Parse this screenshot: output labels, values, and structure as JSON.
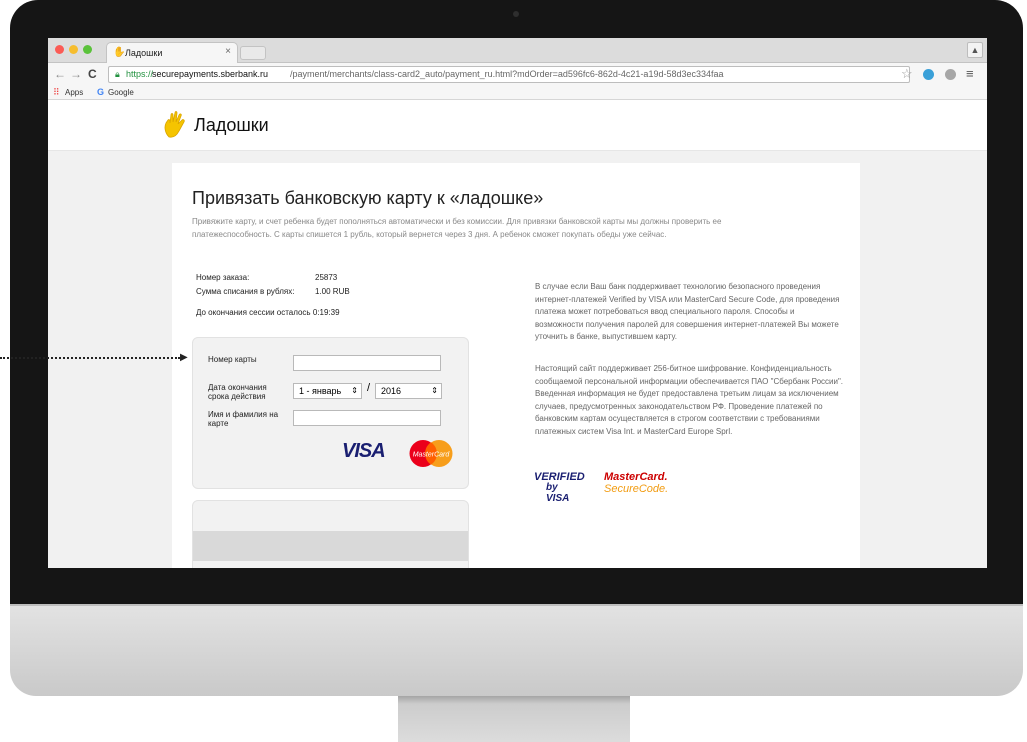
{
  "browser": {
    "tab_title": "Ладошки",
    "tab_close": "×",
    "url_https": "https://",
    "url_host": "securepayments.sberbank.ru",
    "url_path": "/payment/merchants/class-card2_auto/payment_ru.html?mdOrder=ad596fc6-862d-4c21-a19d-58d3ec334faa",
    "bookmarks": [
      {
        "label": "Apps",
        "icon": "apps-grid-icon"
      },
      {
        "label": "Google",
        "icon": "google-icon"
      }
    ]
  },
  "site": {
    "logo_text": "Ладошки",
    "logo_icon": "hand-icon"
  },
  "page": {
    "title": "Привязать банковскую карту к «ладошке»",
    "intro_line_1": "Привяжите карту, и счет ребенка будет пополняться автоматически и без комиссии. Для привязки банковской карты мы должны проверить ее",
    "intro_line_2": "платежеспособность. С карты спишется 1 рубль, который вернется через 3 дня. А ребенок сможет покупать обеды уже сейчас."
  },
  "order": {
    "number_label": "Номер заказа:",
    "number_value": "25873",
    "amount_label": "Сумма списания в рублях:",
    "amount_value": "1.00 RUB",
    "timer_text": "До окончания сессии осталось 0:19:39"
  },
  "form": {
    "card_number_label": "Номер карты",
    "expiry_label": "Дата окончания срока действия",
    "month_value": "1 - январь",
    "slash": "/",
    "year_value": "2016",
    "cardholder_label": "Имя и фамилия на карте",
    "visa_logo_text": "VISA",
    "mastercard_logo_text": "MasterCard"
  },
  "info": {
    "paragraph_1": "В случае если Ваш банк поддерживает технологию безопасного проведения интернет-платежей Verified by VISA или MasterCard Secure Code, для проведения платежа может потребоваться ввод специального пароля. Способы и возможности получения паролей для совершения интернет-платежей Вы можете уточнить в банке, выпустившем карту.",
    "paragraph_2": "Настоящий сайт поддерживает 256-битное шифрование. Конфиденциальность сообщаемой персональной информации обеспечивается ПАО \"Сбербанк России\". Введенная информация не будет предоставлена третьим лицам за исключением случаев, предусмотренных законодательством РФ. Проведение платежей по банковским картам осуществляется в строгом соответствии с требованиями платежных систем Visa Int. и MasterCard Europe Sprl.",
    "verified_line_1": "VERIFIED",
    "verified_line_2": "by VISA",
    "mc_name": "MasterCard.",
    "mc_secure": "SecureCode."
  },
  "colors": {
    "secure_green": "#22913f",
    "visa_blue": "#1a1f71",
    "mastercard_red": "#cc0000",
    "mastercard_orange": "#f29c12",
    "logo_yellow": "#f5c400"
  }
}
